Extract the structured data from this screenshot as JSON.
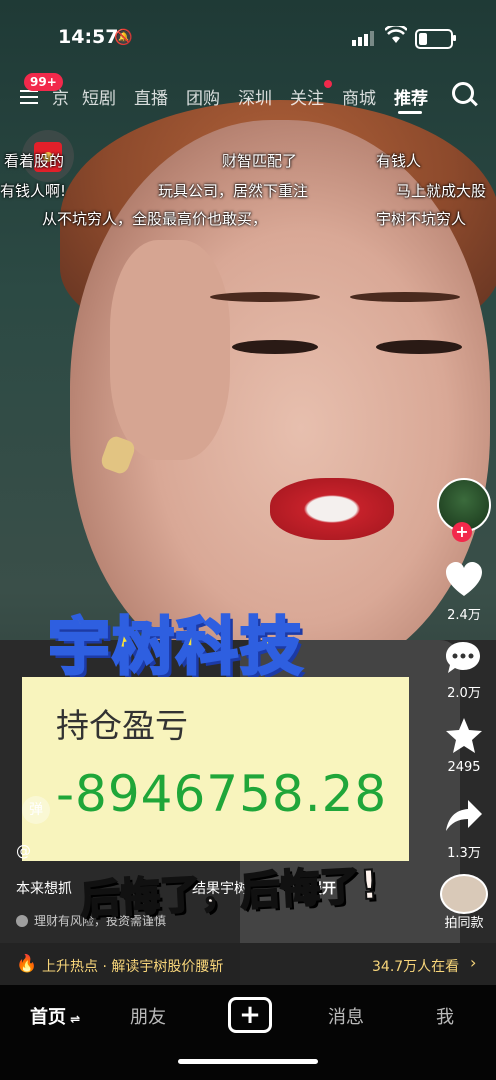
{
  "status_bar": {
    "time": "14:57"
  },
  "top_nav": {
    "badge": "99+",
    "tabs": [
      {
        "label": "京",
        "active": false
      },
      {
        "label": "短剧",
        "active": false
      },
      {
        "label": "直播",
        "active": false
      },
      {
        "label": "团购",
        "active": false
      },
      {
        "label": "深圳",
        "active": false
      },
      {
        "label": "关注",
        "active": false
      },
      {
        "label": "商城",
        "active": false
      },
      {
        "label": "推荐",
        "active": true
      }
    ]
  },
  "subtitles": [
    [
      "看着股的",
      "财智匹配了",
      "有钱人"
    ],
    [
      "有钱人啊!",
      "玩具公司，居然下重注",
      "马上就成大股"
    ],
    [
      "从不坑穷人，全股最高价也敢买，",
      "宇树不坑穷人"
    ]
  ],
  "overlay": {
    "stock_name": "宇树科技",
    "pl_label": "持仓盈亏",
    "pl_value": "-8946758.28",
    "regret_text": "后悔了，后悔了!"
  },
  "side_actions": {
    "likes": "2.4万",
    "comments": "2.0万",
    "favorites": "2495",
    "shares": "1.3万",
    "same_style": "拍同款"
  },
  "caption": {
    "danmu": "弹",
    "author": "@",
    "description": "本来想抓",
    "description_tail": "结果宇树",
    "expand": "展开",
    "risk": "理财有风险，投资需谨慎"
  },
  "hot_bar": {
    "text": "上升热点 · 解读宇树股价腰斩",
    "live_count": "34.7万人在看"
  },
  "bottom_nav": {
    "home": "首页",
    "friends": "朋友",
    "messages": "消息",
    "me": "我"
  },
  "colors": {
    "accent_red": "#f2294b",
    "loss_green": "#1faa3a",
    "title_yellow": "#f8e23b",
    "hot_gold": "#f7d57a"
  },
  "battery_level": 0.3
}
